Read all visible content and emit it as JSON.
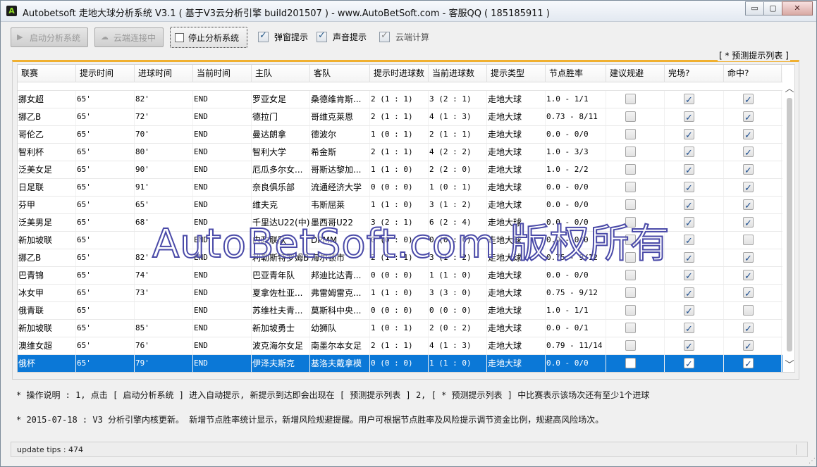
{
  "window": {
    "logo_letter": "A",
    "title": "Autobetsoft 走地大球分析系统 V3.1 ( 基于V3云分析引擎 build201507 ) - www.AutoBetSoft.com - 客服QQ ( 185185911 )",
    "min_glyph": "▭",
    "max_glyph": "▢",
    "close_glyph": "✕"
  },
  "toolbar": {
    "start_label": "启动分析系统",
    "cloud_label": "云端连接中",
    "stop_label": "停止分析系统",
    "popup_label": "弹窗提示",
    "sound_label": "声音提示",
    "cloud_calc_label": "云端计算"
  },
  "group_label": "[ * 预测提示列表 ]",
  "columns": [
    "联赛",
    "提示时间",
    "进球时间",
    "当前时间",
    "主队",
    "客队",
    "提示时进球数",
    "当前进球数",
    "提示类型",
    "节点胜率",
    "建议规避",
    "完场?",
    "命中?"
  ],
  "rows": [
    {
      "league": "挪女超",
      "tip_time": "65'",
      "goal_time": "82'",
      "now": "END",
      "home": "罗亚女足",
      "away": "桑德维肯斯...",
      "tip_score": "2 (1 : 1)",
      "cur_score": "3 (2 : 1)",
      "type": "走地大球",
      "rate": "1.0 - 1/1",
      "avoid": false,
      "finished": true,
      "hit": true
    },
    {
      "league": "挪乙B",
      "tip_time": "65'",
      "goal_time": "72'",
      "now": "END",
      "home": "德拉门",
      "away": "哥维克莱恩",
      "tip_score": "2 (1 : 1)",
      "cur_score": "4 (1 : 3)",
      "type": "走地大球",
      "rate": "0.73 - 8/11",
      "avoid": false,
      "finished": true,
      "hit": true
    },
    {
      "league": "哥伦乙",
      "tip_time": "65'",
      "goal_time": "70'",
      "now": "END",
      "home": "曼达朗拿",
      "away": "德波尔",
      "tip_score": "1 (0 : 1)",
      "cur_score": "2 (1 : 1)",
      "type": "走地大球",
      "rate": "0.0 - 0/0",
      "avoid": false,
      "finished": true,
      "hit": true
    },
    {
      "league": "智利杯",
      "tip_time": "65'",
      "goal_time": "80'",
      "now": "END",
      "home": "智利大学",
      "away": "希金斯",
      "tip_score": "2 (1 : 1)",
      "cur_score": "4 (2 : 2)",
      "type": "走地大球",
      "rate": "1.0 - 3/3",
      "avoid": false,
      "finished": true,
      "hit": true
    },
    {
      "league": "泛美女足",
      "tip_time": "65'",
      "goal_time": "90'",
      "now": "END",
      "home": "厄瓜多尔女...",
      "away": "哥斯达黎加...",
      "tip_score": "1 (1 : 0)",
      "cur_score": "2 (2 : 0)",
      "type": "走地大球",
      "rate": "1.0 - 2/2",
      "avoid": false,
      "finished": true,
      "hit": true
    },
    {
      "league": "日足联",
      "tip_time": "65'",
      "goal_time": "91'",
      "now": "END",
      "home": "奈良俱乐部",
      "away": "流通经济大学",
      "tip_score": "0 (0 : 0)",
      "cur_score": "1 (0 : 1)",
      "type": "走地大球",
      "rate": "0.0 - 0/0",
      "avoid": false,
      "finished": true,
      "hit": true
    },
    {
      "league": "芬甲",
      "tip_time": "65'",
      "goal_time": "65'",
      "now": "END",
      "home": "维夫克",
      "away": "韦斯屈莱",
      "tip_score": "1 (1 : 0)",
      "cur_score": "3 (1 : 2)",
      "type": "走地大球",
      "rate": "0.0 - 0/0",
      "avoid": false,
      "finished": true,
      "hit": true
    },
    {
      "league": "泛美男足",
      "tip_time": "65'",
      "goal_time": "68'",
      "now": "END",
      "home": "千里达U22(中)",
      "away": "墨西哥U22",
      "tip_score": "3 (2 : 1)",
      "cur_score": "6 (2 : 4)",
      "type": "走地大球",
      "rate": "0.0 - 0/0",
      "avoid": false,
      "finished": true,
      "hit": true
    },
    {
      "league": "新加坡联",
      "tip_time": "65'",
      "goal_time": "",
      "now": "END",
      "home": "内政联队",
      "away": "DPMM",
      "tip_score": "0 (0 : 0)",
      "cur_score": "0 (0 : 0)",
      "type": "走地大球",
      "rate": "0.0 - 0/0",
      "avoid": false,
      "finished": true,
      "hit": false
    },
    {
      "league": "挪乙B",
      "tip_time": "65'",
      "goal_time": "82'",
      "now": "END",
      "home": "利勒斯特罗姆B",
      "away": "海尔顿市",
      "tip_score": "2 (1 : 1)",
      "cur_score": "3 (1 : 2)",
      "type": "走地大球",
      "rate": "0.75 - 9/12",
      "avoid": false,
      "finished": true,
      "hit": true
    },
    {
      "league": "巴青锦",
      "tip_time": "65'",
      "goal_time": "74'",
      "now": "END",
      "home": "巴亚青年队",
      "away": "邦迪比达青...",
      "tip_score": "0 (0 : 0)",
      "cur_score": "1 (1 : 0)",
      "type": "走地大球",
      "rate": "0.0 - 0/0",
      "avoid": false,
      "finished": true,
      "hit": true
    },
    {
      "league": "冰女甲",
      "tip_time": "65'",
      "goal_time": "73'",
      "now": "END",
      "home": "夏拿佐杜亚...",
      "away": "弗雷姆雷克...",
      "tip_score": "1 (1 : 0)",
      "cur_score": "3 (3 : 0)",
      "type": "走地大球",
      "rate": "0.75 - 9/12",
      "avoid": false,
      "finished": true,
      "hit": true
    },
    {
      "league": "俄青联",
      "tip_time": "65'",
      "goal_time": "",
      "now": "END",
      "home": "苏维杜夫青...",
      "away": "莫斯科中央...",
      "tip_score": "0 (0 : 0)",
      "cur_score": "0 (0 : 0)",
      "type": "走地大球",
      "rate": "1.0 - 1/1",
      "avoid": false,
      "finished": true,
      "hit": false
    },
    {
      "league": "新加坡联",
      "tip_time": "65'",
      "goal_time": "85'",
      "now": "END",
      "home": "新加坡勇士",
      "away": "幼狮队",
      "tip_score": "1 (0 : 1)",
      "cur_score": "2 (0 : 2)",
      "type": "走地大球",
      "rate": "0.0 - 0/1",
      "avoid": false,
      "finished": true,
      "hit": true
    },
    {
      "league": "澳维女超",
      "tip_time": "65'",
      "goal_time": "76'",
      "now": "END",
      "home": "波克海尔女足",
      "away": "南墨尔本女足",
      "tip_score": "2 (1 : 1)",
      "cur_score": "4 (1 : 3)",
      "type": "走地大球",
      "rate": "0.79 - 11/14",
      "avoid": false,
      "finished": true,
      "hit": true
    },
    {
      "league": "俄杯",
      "tip_time": "65'",
      "goal_time": "79'",
      "now": "END",
      "home": "伊泽夫斯克",
      "away": "基洛夫戴拿模",
      "tip_score": "0 (0 : 0)",
      "cur_score": "1 (1 : 0)",
      "type": "走地大球",
      "rate": "0.0 - 0/0",
      "avoid": false,
      "finished": true,
      "hit": true
    }
  ],
  "selected_row": 15,
  "watermark": "AutoBetSoft.com 版权所有",
  "info_line1": "* 操作说明 : 1, 点击 [ 启动分析系统 ] 进入自动提示, 新提示到达即会出现在 [ 预测提示列表 ] 2, [ * 预测提示列表 ] 中比赛表示该场次还有至少1个进球",
  "info_line2": "* 2015-07-18 :  V3 分析引擎内核更新。 新增节点胜率统计显示，新增风险规避提醒。用户可根据节点胜率及风险提示调节资金比例，规避高风险场次。",
  "status_text": "update tips : 474",
  "colors": {
    "selection": "#0b78d7",
    "group_accent": "#f0b030",
    "watermark_stroke": "#4a4aa8"
  }
}
